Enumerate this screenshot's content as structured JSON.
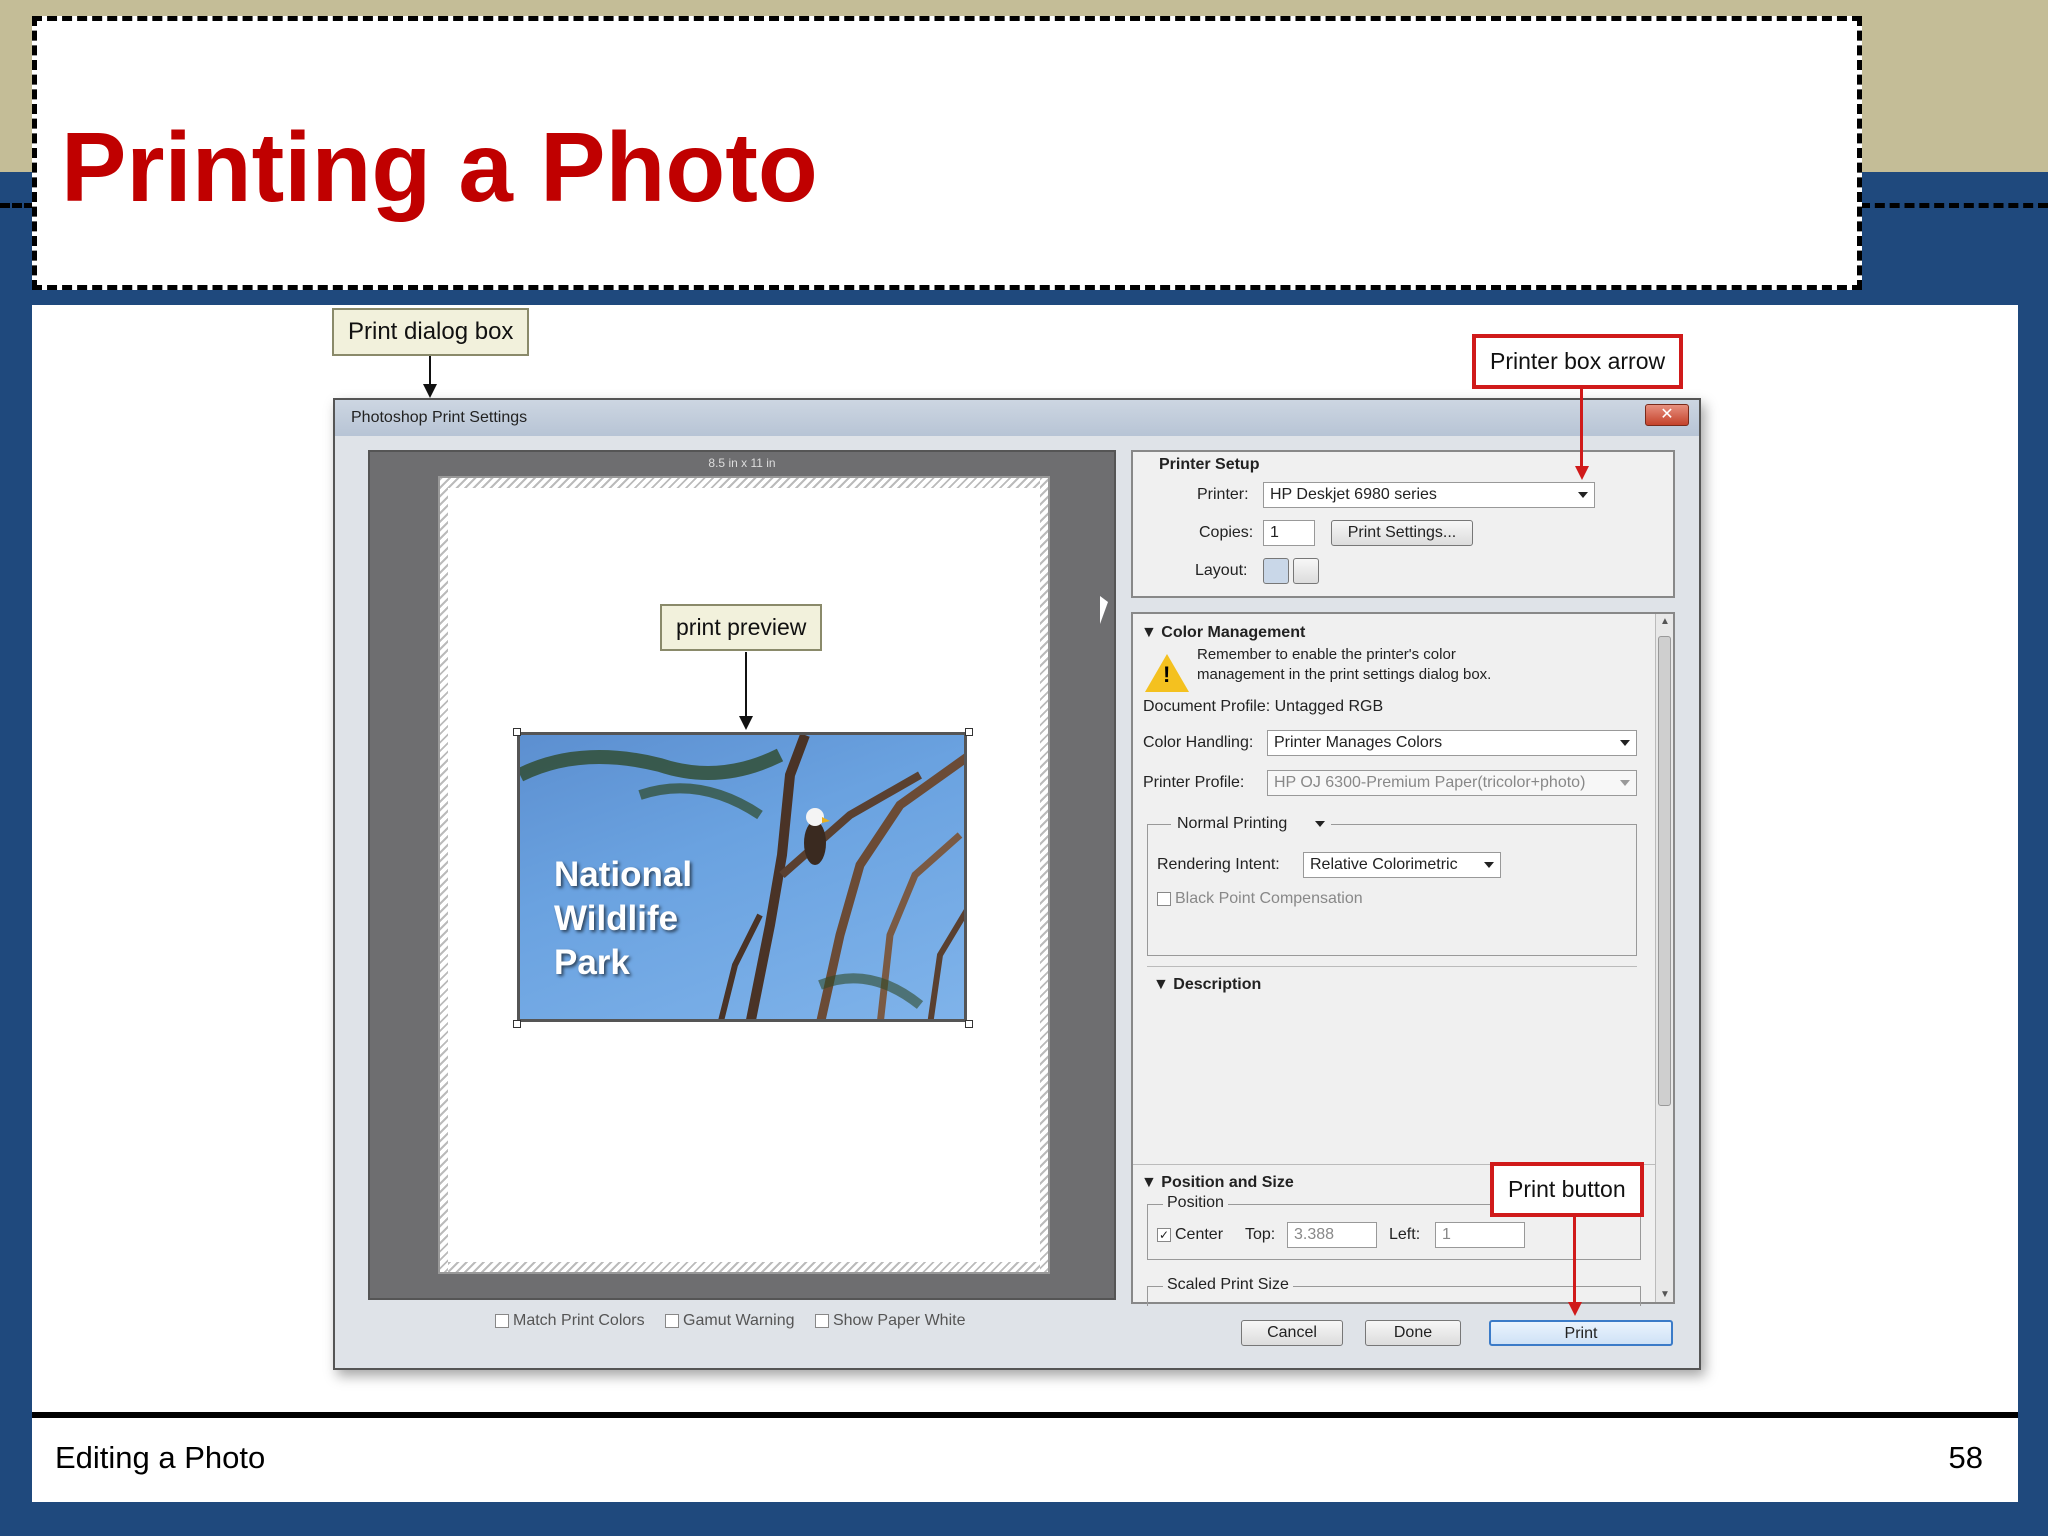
{
  "slide": {
    "title": "Printing a Photo",
    "footer_left": "Editing a Photo",
    "page_number": "58"
  },
  "callouts": {
    "print_dialog_box": "Print dialog box",
    "printer_box_arrow": "Printer box arrow",
    "print_preview": "print preview",
    "print_button": "Print button"
  },
  "dialog": {
    "title": "Photoshop Print Settings",
    "close_glyph": "✕",
    "paper_size": "8.5 in x 11 in",
    "photo_text": [
      "National",
      "Wildlife",
      "Park"
    ],
    "bottom_checks": {
      "match_print_colors": "Match Print Colors",
      "gamut_warning": "Gamut Warning",
      "show_paper_white": "Show Paper White"
    },
    "printer_setup": {
      "heading": "Printer Setup",
      "printer_label": "Printer:",
      "printer_value": "HP Deskjet 6980 series",
      "copies_label": "Copies:",
      "copies_value": "1",
      "print_settings_button": "Print Settings...",
      "layout_label": "Layout:"
    },
    "color_management": {
      "heading": "Color Management",
      "warning_text_1": "Remember to enable the printer's color",
      "warning_text_2": "management in the print settings dialog box.",
      "document_profile": "Document Profile: Untagged RGB",
      "color_handling_label": "Color Handling:",
      "color_handling_value": "Printer Manages Colors",
      "printer_profile_label": "Printer Profile:",
      "printer_profile_value": "HP OJ 6300-Premium Paper(tricolor+photo)",
      "normal_printing": "Normal Printing",
      "rendering_intent_label": "Rendering Intent:",
      "rendering_intent_value": "Relative Colorimetric",
      "black_point": "Black Point Compensation"
    },
    "description": {
      "heading": "Description"
    },
    "position_size": {
      "heading": "Position and Size",
      "position_label": "Position",
      "center_label": "Center",
      "top_label": "Top:",
      "top_value": "3.388",
      "left_label": "Left:",
      "left_value": "1",
      "scaled_label": "Scaled Print Size"
    },
    "buttons": {
      "cancel": "Cancel",
      "done": "Done",
      "print": "Print"
    }
  },
  "colors": {
    "title_red": "#c00000",
    "slide_blue": "#1f497d",
    "top_tan": "#c4bd97",
    "callout_red": "#d01a1a"
  }
}
